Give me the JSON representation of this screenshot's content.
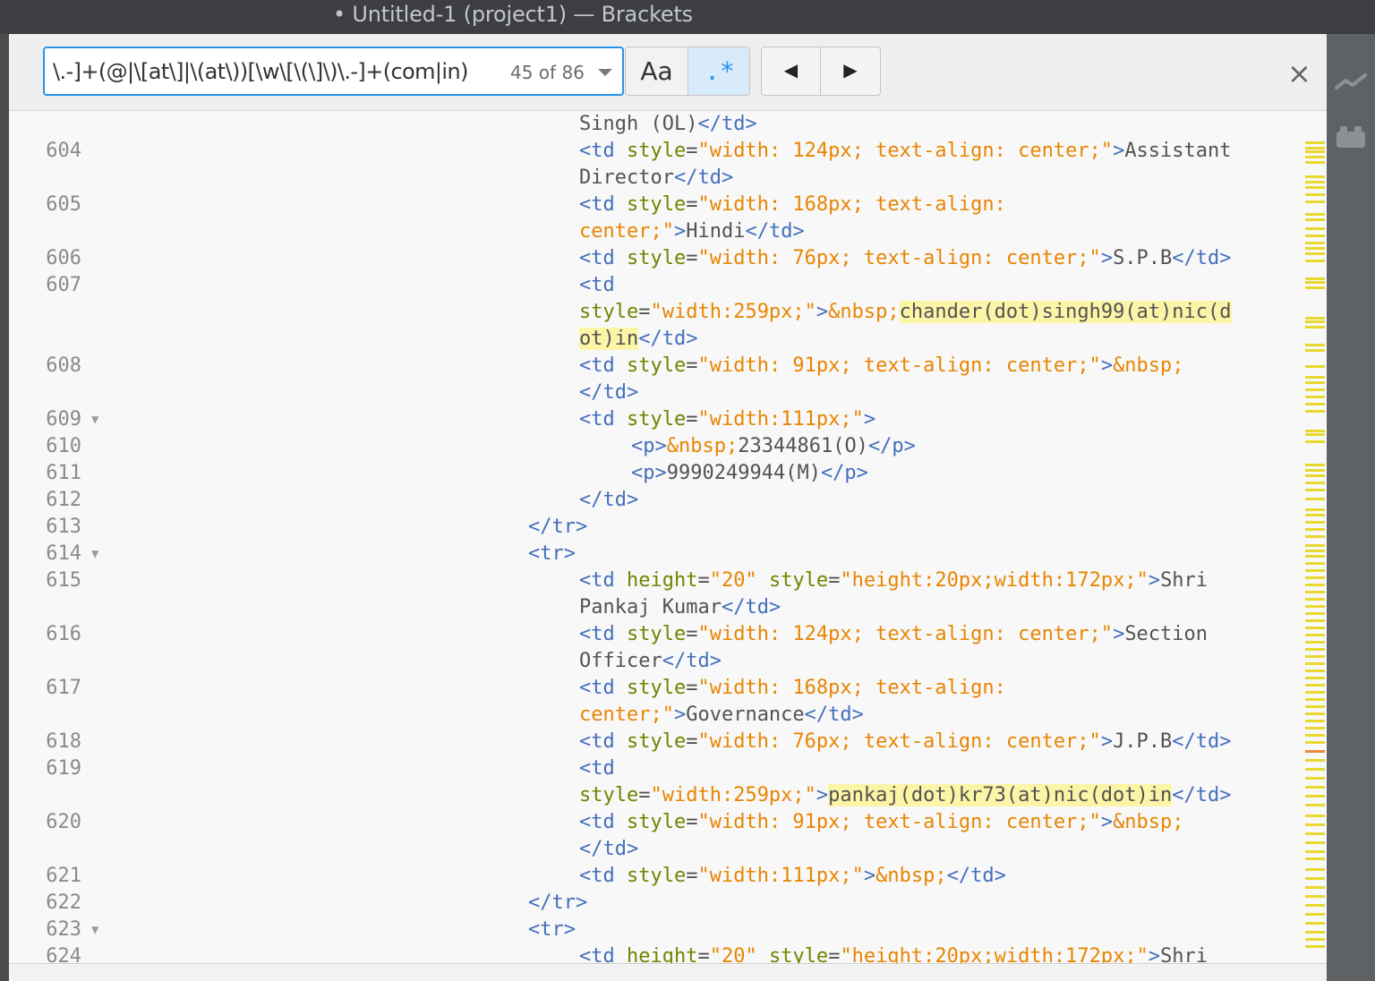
{
  "window": {
    "title": "• Untitled-1 (project1) — Brackets"
  },
  "find": {
    "query": "\\.-]+(@|\\[at\\]|\\(at\\))[\\w\\[\\(\\]\\)\\.-]+(com|in)",
    "count": "45 of 86",
    "case_label": "Aa",
    "regex_label": ".*",
    "prev_label": "◀",
    "next_label": "▶",
    "close_label": "×"
  },
  "editor": {
    "lines": [
      {
        "num": "",
        "fold": false,
        "indent": 2,
        "parts": [
          [
            "x",
            "Singh (OL)"
          ],
          [
            "t",
            "</td>"
          ]
        ]
      },
      {
        "num": "604",
        "fold": false,
        "indent": 2,
        "parts": [
          [
            "t",
            "<td "
          ],
          [
            "a",
            "style"
          ],
          [
            "x",
            "="
          ],
          [
            "v",
            "\"width: 124px; text-align: center;\""
          ],
          [
            "t",
            ">"
          ],
          [
            "x",
            "Assistant"
          ]
        ]
      },
      {
        "num": "",
        "fold": false,
        "indent": 2,
        "parts": [
          [
            "x",
            "Director"
          ],
          [
            "t",
            "</td>"
          ]
        ]
      },
      {
        "num": "605",
        "fold": false,
        "indent": 2,
        "parts": [
          [
            "t",
            "<td "
          ],
          [
            "a",
            "style"
          ],
          [
            "x",
            "="
          ],
          [
            "v",
            "\"width: 168px; text-align:"
          ]
        ]
      },
      {
        "num": "",
        "fold": false,
        "indent": 2,
        "parts": [
          [
            "v",
            "center;\""
          ],
          [
            "t",
            ">"
          ],
          [
            "x",
            "Hindi"
          ],
          [
            "t",
            "</td>"
          ]
        ]
      },
      {
        "num": "606",
        "fold": false,
        "indent": 2,
        "parts": [
          [
            "t",
            "<td "
          ],
          [
            "a",
            "style"
          ],
          [
            "x",
            "="
          ],
          [
            "v",
            "\"width: 76px; text-align: center;\""
          ],
          [
            "t",
            ">"
          ],
          [
            "x",
            "S.P.B"
          ],
          [
            "t",
            "</td>"
          ]
        ]
      },
      {
        "num": "607",
        "fold": false,
        "indent": 2,
        "parts": [
          [
            "t",
            "<td"
          ]
        ]
      },
      {
        "num": "",
        "fold": false,
        "indent": 2,
        "parts": [
          [
            "a",
            "style"
          ],
          [
            "x",
            "="
          ],
          [
            "v",
            "\"width:259px;\""
          ],
          [
            "t",
            ">"
          ],
          [
            "e",
            "&nbsp;"
          ],
          [
            "h",
            "chander(dot)singh99(at)nic(d"
          ]
        ]
      },
      {
        "num": "",
        "fold": false,
        "indent": 2,
        "parts": [
          [
            "h",
            "ot)in"
          ],
          [
            "t",
            "</td>"
          ]
        ]
      },
      {
        "num": "608",
        "fold": false,
        "indent": 2,
        "parts": [
          [
            "t",
            "<td "
          ],
          [
            "a",
            "style"
          ],
          [
            "x",
            "="
          ],
          [
            "v",
            "\"width: 91px; text-align: center;\""
          ],
          [
            "t",
            ">"
          ],
          [
            "e",
            "&nbsp;"
          ]
        ]
      },
      {
        "num": "",
        "fold": false,
        "indent": 2,
        "parts": [
          [
            "t",
            "</td>"
          ]
        ]
      },
      {
        "num": "609",
        "fold": true,
        "indent": 2,
        "parts": [
          [
            "t",
            "<td "
          ],
          [
            "a",
            "style"
          ],
          [
            "x",
            "="
          ],
          [
            "v",
            "\"width:111px;\""
          ],
          [
            "t",
            ">"
          ]
        ]
      },
      {
        "num": "610",
        "fold": false,
        "indent": 3,
        "parts": [
          [
            "t",
            "<p>"
          ],
          [
            "e",
            "&nbsp;"
          ],
          [
            "x",
            "23344861(O)"
          ],
          [
            "t",
            "</p>"
          ]
        ]
      },
      {
        "num": "611",
        "fold": false,
        "indent": 3,
        "parts": [
          [
            "t",
            "<p>"
          ],
          [
            "x",
            "9990249944(M)"
          ],
          [
            "t",
            "</p>"
          ]
        ]
      },
      {
        "num": "612",
        "fold": false,
        "indent": 2,
        "parts": [
          [
            "t",
            "</td>"
          ]
        ]
      },
      {
        "num": "613",
        "fold": false,
        "indent": 1,
        "parts": [
          [
            "t",
            "</tr>"
          ]
        ]
      },
      {
        "num": "614",
        "fold": true,
        "indent": 1,
        "parts": [
          [
            "t",
            "<tr>"
          ]
        ]
      },
      {
        "num": "615",
        "fold": false,
        "indent": 2,
        "parts": [
          [
            "t",
            "<td "
          ],
          [
            "a",
            "height"
          ],
          [
            "x",
            "="
          ],
          [
            "v",
            "\"20\" "
          ],
          [
            "a",
            "style"
          ],
          [
            "x",
            "="
          ],
          [
            "v",
            "\"height:20px;width:172px;\""
          ],
          [
            "t",
            ">"
          ],
          [
            "x",
            "Shri"
          ]
        ]
      },
      {
        "num": "",
        "fold": false,
        "indent": 2,
        "parts": [
          [
            "x",
            "Pankaj Kumar"
          ],
          [
            "t",
            "</td>"
          ]
        ]
      },
      {
        "num": "616",
        "fold": false,
        "indent": 2,
        "parts": [
          [
            "t",
            "<td "
          ],
          [
            "a",
            "style"
          ],
          [
            "x",
            "="
          ],
          [
            "v",
            "\"width: 124px; text-align: center;\""
          ],
          [
            "t",
            ">"
          ],
          [
            "x",
            "Section"
          ]
        ]
      },
      {
        "num": "",
        "fold": false,
        "indent": 2,
        "parts": [
          [
            "x",
            "Officer"
          ],
          [
            "t",
            "</td>"
          ]
        ]
      },
      {
        "num": "617",
        "fold": false,
        "indent": 2,
        "parts": [
          [
            "t",
            "<td "
          ],
          [
            "a",
            "style"
          ],
          [
            "x",
            "="
          ],
          [
            "v",
            "\"width: 168px; text-align:"
          ]
        ]
      },
      {
        "num": "",
        "fold": false,
        "indent": 2,
        "parts": [
          [
            "v",
            "center;\""
          ],
          [
            "t",
            ">"
          ],
          [
            "x",
            "Governance"
          ],
          [
            "t",
            "</td>"
          ]
        ]
      },
      {
        "num": "618",
        "fold": false,
        "indent": 2,
        "parts": [
          [
            "t",
            "<td "
          ],
          [
            "a",
            "style"
          ],
          [
            "x",
            "="
          ],
          [
            "v",
            "\"width: 76px; text-align: center;\""
          ],
          [
            "t",
            ">"
          ],
          [
            "x",
            "J.P.B"
          ],
          [
            "t",
            "</td>"
          ]
        ]
      },
      {
        "num": "619",
        "fold": false,
        "indent": 2,
        "parts": [
          [
            "t",
            "<td"
          ]
        ]
      },
      {
        "num": "",
        "fold": false,
        "indent": 2,
        "parts": [
          [
            "a",
            "style"
          ],
          [
            "x",
            "="
          ],
          [
            "v",
            "\"width:259px;\""
          ],
          [
            "t",
            ">"
          ],
          [
            "h",
            "pankaj(dot)kr73(at)nic(dot)in"
          ],
          [
            "t",
            "</td>"
          ]
        ]
      },
      {
        "num": "620",
        "fold": false,
        "indent": 2,
        "parts": [
          [
            "t",
            "<td "
          ],
          [
            "a",
            "style"
          ],
          [
            "x",
            "="
          ],
          [
            "v",
            "\"width: 91px; text-align: center;\""
          ],
          [
            "t",
            ">"
          ],
          [
            "e",
            "&nbsp;"
          ]
        ]
      },
      {
        "num": "",
        "fold": false,
        "indent": 2,
        "parts": [
          [
            "t",
            "</td>"
          ]
        ]
      },
      {
        "num": "621",
        "fold": false,
        "indent": 2,
        "parts": [
          [
            "t",
            "<td "
          ],
          [
            "a",
            "style"
          ],
          [
            "x",
            "="
          ],
          [
            "v",
            "\"width:111px;\""
          ],
          [
            "t",
            ">"
          ],
          [
            "e",
            "&nbsp;"
          ],
          [
            "t",
            "</td>"
          ]
        ]
      },
      {
        "num": "622",
        "fold": false,
        "indent": 1,
        "parts": [
          [
            "t",
            "</tr>"
          ]
        ]
      },
      {
        "num": "623",
        "fold": true,
        "indent": 1,
        "parts": [
          [
            "t",
            "<tr>"
          ]
        ]
      },
      {
        "num": "624",
        "fold": false,
        "indent": 2,
        "parts": [
          [
            "t",
            "<td "
          ],
          [
            "a",
            "height"
          ],
          [
            "x",
            "="
          ],
          [
            "v",
            "\"20\" "
          ],
          [
            "a",
            "style"
          ],
          [
            "x",
            "="
          ],
          [
            "v",
            "\"height:20px;width:172px;\""
          ],
          [
            "t",
            ">"
          ],
          [
            "x",
            "Shri"
          ]
        ]
      }
    ]
  },
  "icons": {
    "live_preview": "live-preview-icon",
    "extension_manager": "extension-manager-icon",
    "fold_marker": "fold-triangle-icon"
  },
  "colors": {
    "tag": "#446fbd",
    "attribute": "#6d8600",
    "value": "#e88501",
    "text": "#535353",
    "match_highlight": "#fcf4a7",
    "find_border": "#2893ef"
  }
}
